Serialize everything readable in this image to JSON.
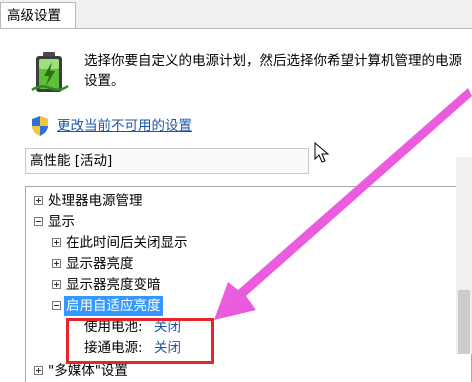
{
  "tab": {
    "label": "高级设置"
  },
  "description": "选择你要自定义的电源计划，然后选择你希望计算机管理的电源设置。",
  "change_link": "更改当前不可用的设置",
  "plan_select": {
    "value": "高性能 [活动]"
  },
  "tree": {
    "cpu": "处理器电源管理",
    "display": "显示",
    "turn_off": "在此时间后关闭显示",
    "brightness": "显示器亮度",
    "dimmed": "显示器亮度变暗",
    "adaptive": "启用自适应亮度",
    "battery_label": "使用电池:",
    "battery_value": "关闭",
    "plugged_label": "接通电源:",
    "plugged_value": "关闭",
    "multimedia": "\"多媒体\"设置"
  },
  "colors": {
    "highlight": "#3399ff",
    "link": "#1a56a8",
    "annotation_box": "#e8242a",
    "arrow": "#e829d8"
  },
  "icons": [
    "battery-power-icon",
    "uac-shield-icon",
    "mouse-cursor-icon",
    "annotation-arrow"
  ]
}
